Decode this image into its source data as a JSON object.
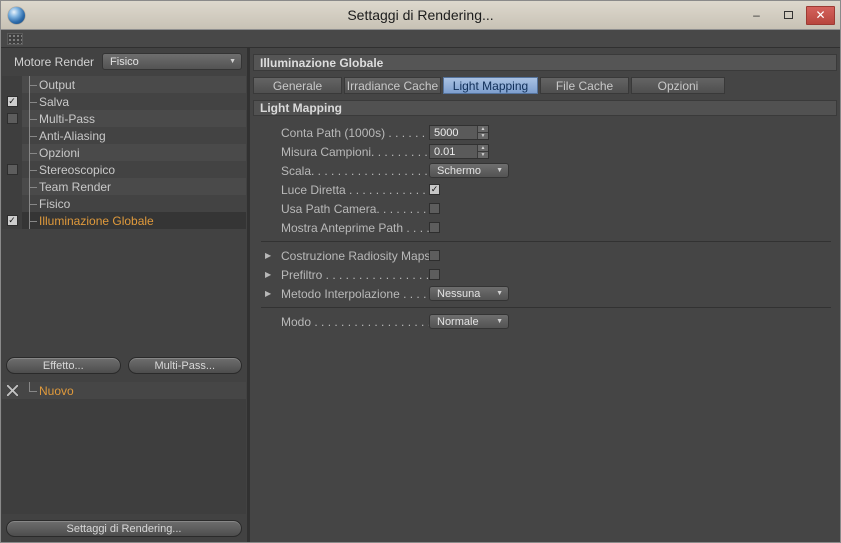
{
  "window": {
    "title": "Settaggi di Rendering...",
    "minimize": "–",
    "close": "✕"
  },
  "colors": {
    "accent_orange": "#e09a3c",
    "tab_active_bg": "#8fb0d8",
    "tab_active_text": "#0f2e57",
    "titlebar_bg": "#d3cdc1",
    "close_red": "#c4544c"
  },
  "left": {
    "engine_label": "Motore Render",
    "engine_value": "Fisico",
    "tree": [
      {
        "label": "Output",
        "check": "",
        "state": "none"
      },
      {
        "label": "Salva",
        "check": "✓",
        "state": "checked"
      },
      {
        "label": "Multi-Pass",
        "check": "",
        "state": "unchecked"
      },
      {
        "label": "Anti-Aliasing",
        "check": "",
        "state": "none"
      },
      {
        "label": "Opzioni",
        "check": "",
        "state": "none"
      },
      {
        "label": "Stereoscopico",
        "check": "",
        "state": "unchecked"
      },
      {
        "label": "Team Render",
        "check": "",
        "state": "none"
      },
      {
        "label": "Fisico",
        "check": "",
        "state": "none"
      },
      {
        "label": "Illuminazione Globale",
        "check": "✓",
        "state": "checked"
      }
    ],
    "effect_button": "Effetto...",
    "multipass_button": "Multi-Pass...",
    "new_item": "Nuovo",
    "bottom_button": "Settaggi di Rendering..."
  },
  "right": {
    "header": "Illuminazione Globale",
    "tabs": [
      "Generale",
      "Irradiance Cache",
      "Light Mapping",
      "File Cache",
      "Opzioni"
    ],
    "active_tab": "Light Mapping",
    "section": "Light Mapping",
    "fields": {
      "conta_path": {
        "label": "Conta Path (1000s) . . . . . . . . . .",
        "value": "5000"
      },
      "misura_campioni": {
        "label": "Misura Campioni. . . . . . . . . . . .",
        "value": "0.01"
      },
      "scala": {
        "label": "Scala. . . . . . . . . . . . . . . . . . . . . .",
        "value": "Schermo"
      },
      "luce_diretta": {
        "label": "Luce Diretta . . . . . . . . . . . . . . .",
        "check": "✓",
        "state": "checked"
      },
      "usa_path_camera": {
        "label": "Usa Path Camera. . . . . . . . . . . .",
        "check": "",
        "state": "unchecked"
      },
      "mostra_anteprime": {
        "label": "Mostra Anteprime Path . . . . . .",
        "check": "",
        "state": "unchecked"
      },
      "costruzione_radiosity": {
        "label": "Costruzione Radiosity Maps",
        "check": "",
        "state": "unchecked"
      },
      "prefiltro": {
        "label": "Prefiltro . . . . . . . . . . . . . . . . . .",
        "check": "",
        "state": "unchecked"
      },
      "metodo_interpolazione": {
        "label": "Metodo Interpolazione . . . . . .",
        "value": "Nessuna"
      },
      "modo": {
        "label": "Modo . . . . . . . . . . . . . . . . . . . .",
        "value": "Normale"
      }
    }
  }
}
